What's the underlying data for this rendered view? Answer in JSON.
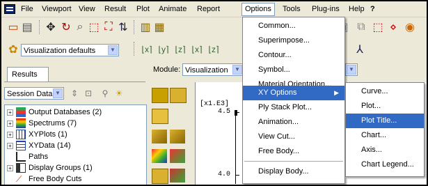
{
  "menubar": {
    "items": [
      "File",
      "Viewport",
      "View",
      "Result",
      "Plot",
      "Animate",
      "Report",
      "Options",
      "Tools",
      "Plug-ins",
      "Help",
      "?"
    ]
  },
  "toolbar": {
    "viz_defaults": "Visualization defaults"
  },
  "results_panel": {
    "tab": "Results",
    "session_combo": "Session Data",
    "tree": [
      {
        "label": "Output Databases (2)",
        "icon": "database-icon"
      },
      {
        "label": "Spectrums (7)",
        "icon": "spectrum-icon"
      },
      {
        "label": "XYPlots (1)",
        "icon": "xyplot-icon"
      },
      {
        "label": "XYData (14)",
        "icon": "xydata-icon"
      },
      {
        "label": "Paths",
        "icon": "path-icon"
      },
      {
        "label": "Display Groups (1)",
        "icon": "display-group-icon"
      },
      {
        "label": "Free Body Cuts",
        "icon": "free-body-icon"
      }
    ]
  },
  "module": {
    "label": "Module:",
    "value": "Visualization"
  },
  "plot": {
    "scale": "[x1.E3]",
    "tick_top": "4.5",
    "tick_bottom": "4.0"
  },
  "options_menu": {
    "items": [
      "Common...",
      "Superimpose...",
      "Contour...",
      "Symbol...",
      "Material Orientation...",
      "XY Options",
      "Ply Stack Plot...",
      "Animation...",
      "View Cut...",
      "Free Body...",
      "Display Body..."
    ]
  },
  "xy_submenu": {
    "items": [
      "Curve...",
      "Plot...",
      "Plot Title...",
      "Chart...",
      "Axis...",
      "Chart Legend..."
    ]
  }
}
